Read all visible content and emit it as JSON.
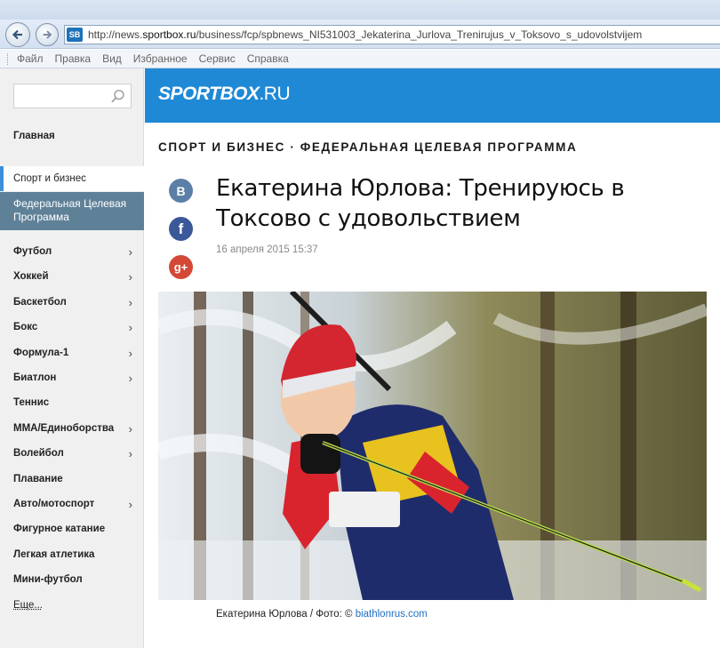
{
  "browser": {
    "url_prefix": "http://news.",
    "url_domain": "sportbox.ru",
    "url_path": "/business/fcp/spbnews_NI531003_Jekaterina_Jurlova_Trenirujus_v_Toksovo_s_udovolstvijem",
    "favicon_text": "SB",
    "menu": [
      "Файл",
      "Правка",
      "Вид",
      "Избранное",
      "Сервис",
      "Справка"
    ]
  },
  "site": {
    "logo_main": "SPORTBOX",
    "logo_suffix": ".RU",
    "accent_color": "#1f89d6"
  },
  "sidebar": {
    "search_placeholder": "",
    "home": "Главная",
    "active_section": "Спорт и бизнес",
    "active_subsection": "Федеральная Целевая Программа",
    "items": [
      {
        "label": "Футбол",
        "has_submenu": true
      },
      {
        "label": "Хоккей",
        "has_submenu": true
      },
      {
        "label": "Баскетбол",
        "has_submenu": true
      },
      {
        "label": "Бокс",
        "has_submenu": true
      },
      {
        "label": "Формула-1",
        "has_submenu": true
      },
      {
        "label": "Биатлон",
        "has_submenu": true
      },
      {
        "label": "Теннис",
        "has_submenu": false
      },
      {
        "label": "MMA/Единоборства",
        "has_submenu": true
      },
      {
        "label": "Волейбол",
        "has_submenu": true
      },
      {
        "label": "Плавание",
        "has_submenu": false
      },
      {
        "label": "Авто/мотоспорт",
        "has_submenu": true
      },
      {
        "label": "Фигурное катание",
        "has_submenu": false
      },
      {
        "label": "Легкая атлетика",
        "has_submenu": false
      },
      {
        "label": "Мини-футбол",
        "has_submenu": false
      }
    ],
    "more": "Еще..."
  },
  "article": {
    "breadcrumb": "СПОРТ И БИЗНЕС · ФЕДЕРАЛЬНАЯ ЦЕЛЕВАЯ ПРОГРАММА",
    "title": "Екатерина Юрлова: Тренируюсь в Токсово с удовольствием",
    "date": "16 апреля 2015 15:37",
    "share": {
      "vk": "В",
      "fb": "f",
      "gplus": "g+"
    },
    "photo_alt_icons": [
      "biathlete-photo"
    ],
    "caption_text": "Екатерина Юрлова / Фото: © ",
    "caption_link": "biathlonrus.com"
  }
}
